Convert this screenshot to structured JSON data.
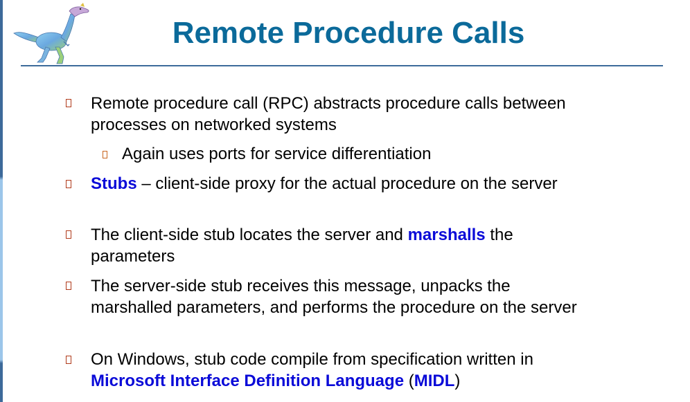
{
  "slide": {
    "title": "Remote Procedure Calls",
    "bullets": [
      {
        "level": 1,
        "parts": [
          {
            "text": "Remote procedure call (RPC) abstracts procedure calls between processes on networked systems",
            "emphasis": false
          }
        ]
      },
      {
        "level": 2,
        "parts": [
          {
            "text": "Again uses ports for service differentiation",
            "emphasis": false
          }
        ]
      },
      {
        "level": 1,
        "parts": [
          {
            "text": "Stubs",
            "emphasis": true
          },
          {
            "text": " – client-side proxy for the actual procedure on the server",
            "emphasis": false
          }
        ]
      },
      {
        "level": 1,
        "parts": [
          {
            "text": "The client-side stub locates the server and ",
            "emphasis": false
          },
          {
            "text": "marshalls",
            "emphasis": true
          },
          {
            "text": " the parameters",
            "emphasis": false
          }
        ]
      },
      {
        "level": 1,
        "parts": [
          {
            "text": "The server-side stub receives this message, unpacks the marshalled parameters, and performs the procedure on the server",
            "emphasis": false
          }
        ]
      },
      {
        "level": 1,
        "parts": [
          {
            "text": "On Windows, stub code compile from specification written in ",
            "emphasis": false
          },
          {
            "text": "Microsoft Interface Definition Language",
            "emphasis": true
          },
          {
            "text": " (",
            "emphasis": false
          },
          {
            "text": "MIDL",
            "emphasis": true
          },
          {
            "text": ")",
            "emphasis": false
          }
        ]
      }
    ]
  },
  "colors": {
    "title": "#0b6a9a",
    "emphasis": "#0a0ad8",
    "bullet_marker": "#b03a1a",
    "sub_bullet_marker": "#c8641e",
    "rule": "#3d6a9a"
  },
  "icons": {
    "logo": "dinosaur-logo-icon",
    "bullet": "hollow-square-bullet-icon"
  }
}
